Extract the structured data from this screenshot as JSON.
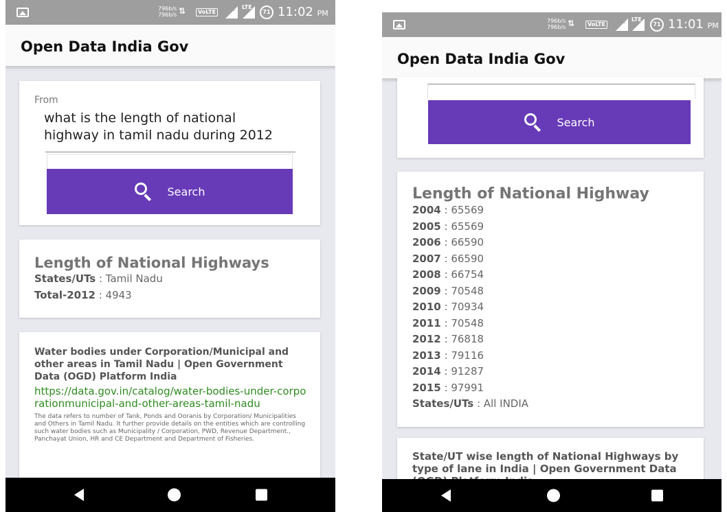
{
  "status_left": {
    "speed_up": "796b/s",
    "speed_down": "796b/s",
    "volte": "VoLTE",
    "lte": "LTE",
    "battery": "71",
    "time": "11:02",
    "ampm": "PM"
  },
  "status_right": {
    "speed_up": "796b/s",
    "speed_down": "796b/s",
    "volte": "VoLTE",
    "lte": "LTE",
    "battery": "71",
    "time": "11:01",
    "ampm": "PM"
  },
  "app": {
    "title": "Open Data India Gov"
  },
  "search": {
    "from_label": "From",
    "query": "what is the length of national highway in tamil nadu during 2012",
    "button_label": "Search"
  },
  "left_result": {
    "title": "Length of National Highways",
    "rows": [
      {
        "key": "States/UTs",
        "value": "Tamil Nadu"
      },
      {
        "key": "Total-2012",
        "value": "4943"
      }
    ]
  },
  "left_ogd": {
    "title": "Water bodies under Corporation/Municipal and other areas in Tamil Nadu | Open Government Data (OGD) Platform India",
    "link": "https://data.gov.in/catalog/water-bodies-under-corporationmunicipal-and-other-areas-tamil-nadu",
    "description": "The data refers to number of Tank, Ponds and Ooranis by Corporation/ Municipalities and Others in Tamil Nadu. It further provide details on the entities which are controlling such water bodies such as Municipality / Corporation, PWD, Revenue Department., Panchayat Union, HR and CE Department and Department of Fisheries."
  },
  "right_result": {
    "title": "Length of National Highway",
    "rows": [
      {
        "key": "2004",
        "value": "65569"
      },
      {
        "key": "2005",
        "value": "65569"
      },
      {
        "key": "2006",
        "value": "66590"
      },
      {
        "key": "2007",
        "value": "66590"
      },
      {
        "key": "2008",
        "value": "66754"
      },
      {
        "key": "2009",
        "value": "70548"
      },
      {
        "key": "2010",
        "value": "70934"
      },
      {
        "key": "2011",
        "value": "70548"
      },
      {
        "key": "2012",
        "value": "76818"
      },
      {
        "key": "2013",
        "value": "79116"
      },
      {
        "key": "2014",
        "value": "91287"
      },
      {
        "key": "2015",
        "value": "97991"
      },
      {
        "key": "States/UTs",
        "value": "All INDIA"
      }
    ]
  },
  "right_ogd": {
    "title": "State/UT wise length of National Highways by type of lane in India | Open Government Data (OGD) Platform India"
  },
  "navbar": {
    "icons": [
      "back-icon",
      "home-icon",
      "recent-apps-icon"
    ]
  }
}
